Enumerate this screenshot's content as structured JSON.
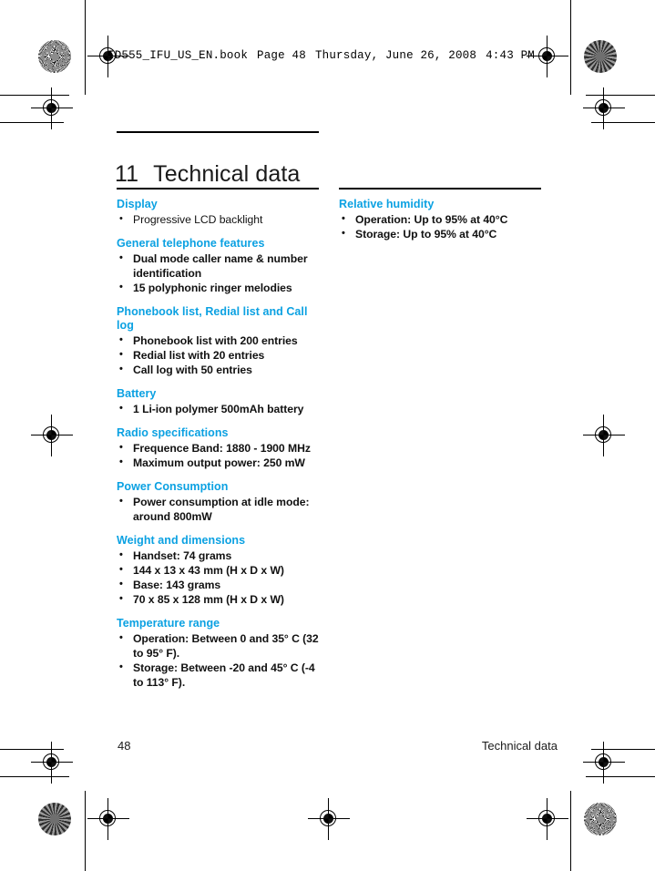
{
  "runhead": {
    "filename": "ID555_IFU_US_EN.book",
    "page_label": "Page 48",
    "date": "Thursday, June 26, 2008",
    "time": "4:43 PM"
  },
  "chapter": {
    "number": "11",
    "title": "Technical data"
  },
  "accent_color": "#0BA1E2",
  "columns": {
    "left": [
      {
        "heading": "Display",
        "items": [
          "Progressive LCD backlight"
        ]
      },
      {
        "heading": "General telephone features",
        "items": [
          "Dual mode caller name & number identification",
          "15 polyphonic ringer melodies"
        ]
      },
      {
        "heading": "Phonebook list, Redial list and Call log",
        "items": [
          "Phonebook list with 200 entries",
          "Redial list with 20 entries",
          "Call log with 50 entries"
        ]
      },
      {
        "heading": "Battery",
        "items": [
          "1 Li-ion polymer 500mAh battery"
        ]
      },
      {
        "heading": "Radio specifications",
        "items": [
          "Frequence Band: 1880 - 1900 MHz",
          "Maximum output power: 250 mW"
        ]
      },
      {
        "heading": "Power Consumption",
        "items": [
          "Power consumption at idle mode: around 800mW"
        ]
      },
      {
        "heading": "Weight and dimensions",
        "items": [
          "Handset: 74 grams",
          "144 x 13 x 43 mm (H x D x W)",
          "Base: 143 grams",
          "70 x 85 x 128 mm (H x D x W)"
        ]
      },
      {
        "heading": "Temperature range",
        "items": [
          "Operation: Between 0 and 35° C (32 to 95° F).",
          "Storage: Between -20 and 45° C (-4 to 113° F)."
        ]
      }
    ],
    "right": [
      {
        "heading": "Relative humidity",
        "items": [
          "Operation: Up to 95% at 40°C",
          "Storage: Up to 95% at 40°C"
        ]
      }
    ]
  },
  "footer": {
    "page_number": "48",
    "section": "Technical data"
  }
}
